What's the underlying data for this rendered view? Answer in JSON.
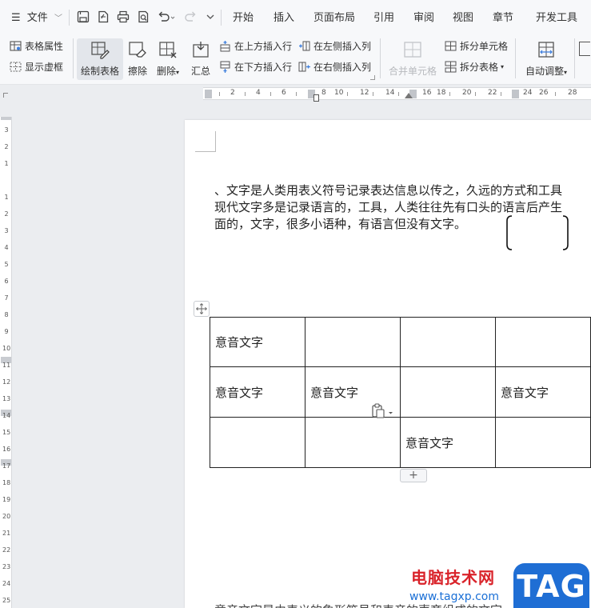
{
  "menubar": {
    "file_label": "文件",
    "tabs": [
      "开始",
      "插入",
      "页面布局",
      "引用",
      "审阅",
      "视图",
      "章节",
      "开发工具"
    ]
  },
  "ribbon": {
    "table_props": "表格属性",
    "show_gridlines": "显示虚框",
    "draw_table": "绘制表格",
    "eraser": "擦除",
    "delete": "删除",
    "summary": "汇总",
    "insert_row_above": "在上方插入行",
    "insert_row_below": "在下方插入行",
    "insert_col_left": "在左侧插入列",
    "insert_col_right": "在右侧插入列",
    "merge_cells": "合并单元格",
    "split_cells": "拆分单元格",
    "split_table": "拆分表格",
    "auto_adjust": "自动调整"
  },
  "ruler": {
    "h_ticks": [
      "2",
      "4",
      "6",
      "8",
      "10",
      "12",
      "14",
      "16",
      "18",
      "20",
      "22",
      "24",
      "26",
      "28"
    ],
    "v_ticks": [
      "3",
      "2",
      "1",
      "1",
      "1",
      "2",
      "3",
      "4",
      "5",
      "6",
      "7",
      "8",
      "9",
      "10",
      "11",
      "12",
      "13",
      "14",
      "15",
      "16",
      "17",
      "18",
      "19",
      "20",
      "21",
      "22",
      "23",
      "24",
      "25"
    ]
  },
  "document": {
    "paragraph_lines": [
      "、文字是人类用表义符号记录表达信息以传之，久远的方式和工具",
      "现代文字多是记录语言的，工具，人类往往先有口头的语言后产生",
      "面的，文字，很多小语种，有语言但没有文字。"
    ],
    "table": [
      [
        "意音文字",
        "",
        "",
        ""
      ],
      [
        "意音文字",
        "意音文字",
        "",
        "意音文字"
      ],
      [
        "",
        "",
        "意音文字",
        ""
      ]
    ],
    "add_row_label": "+",
    "bottom_line_text": "意音文字是由表义的象形符号和表音的声旁组成的文字"
  },
  "watermark": {
    "site_name": "电脑技术网",
    "url": "www.tagxp.com",
    "logo_text": "TAG"
  },
  "colors": {
    "menu_bg": "#f7f8fa",
    "workspace_bg": "#ebedf0",
    "watermark_red": "#d9232a",
    "watermark_blue": "#1f6ed4"
  }
}
